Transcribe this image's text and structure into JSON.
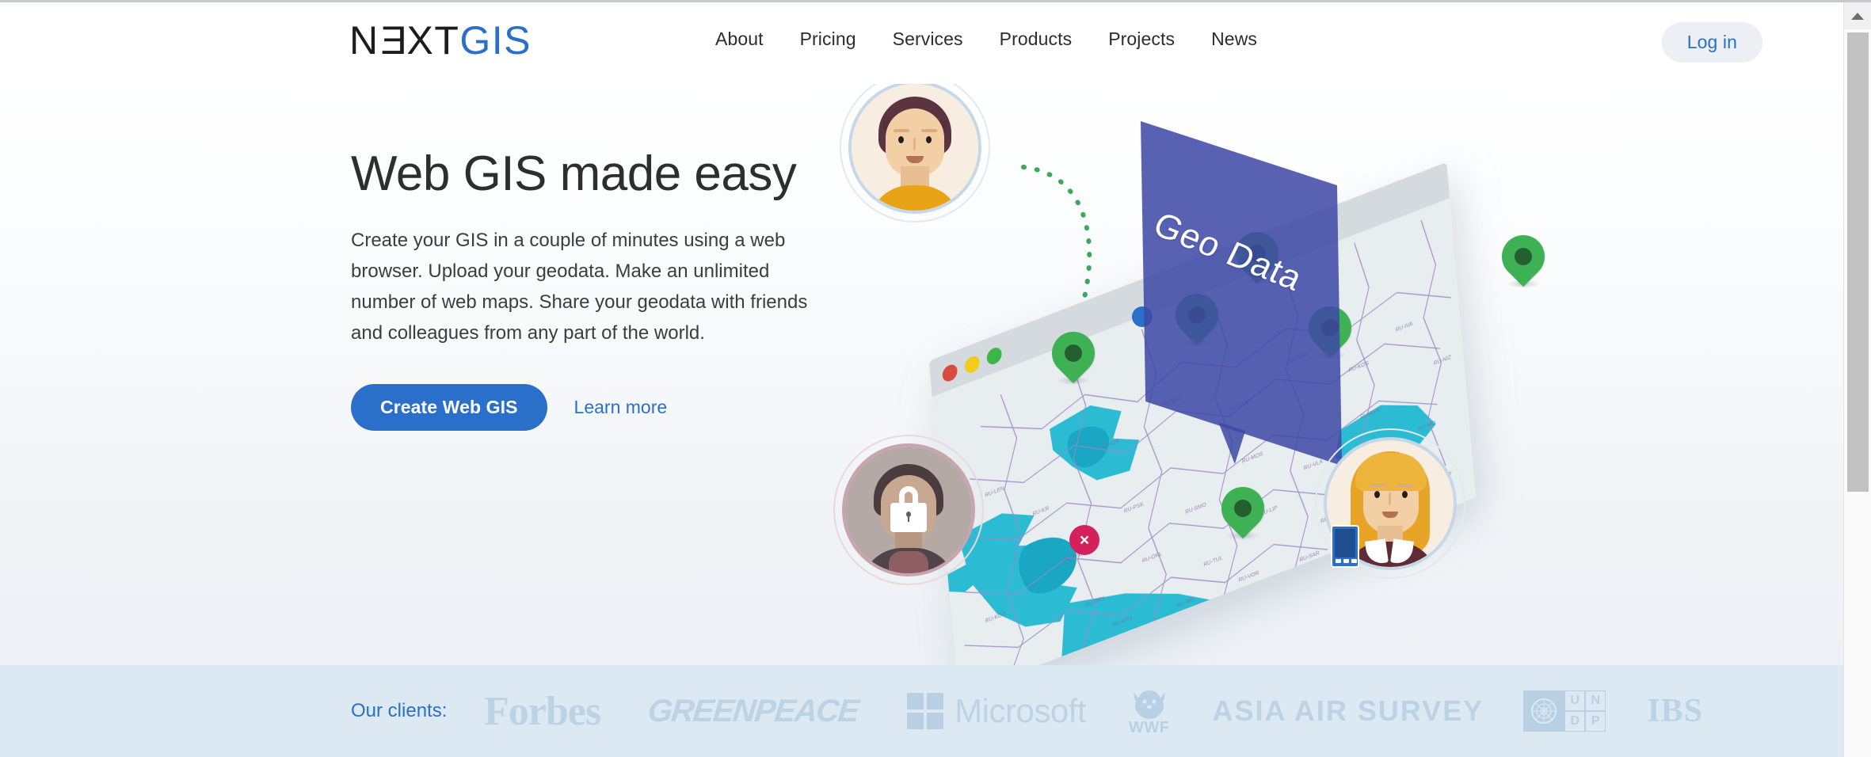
{
  "brand": {
    "logo_text_dark_1": "N",
    "logo_text_e": "E",
    "logo_text_dark_2": "XT",
    "logo_text_blue": "GIS",
    "logo_full": "NEXTGIS",
    "accent_blue": "#2a6fc9",
    "marker_green": "#3eb155",
    "bubble_indigo": "#3e48a5",
    "alert_crimson": "#d3215c"
  },
  "header": {
    "nav": [
      {
        "label": "About"
      },
      {
        "label": "Pricing"
      },
      {
        "label": "Services"
      },
      {
        "label": "Products"
      },
      {
        "label": "Projects"
      },
      {
        "label": "News"
      }
    ],
    "login_label": "Log in"
  },
  "hero": {
    "title": "Web GIS made easy",
    "subtitle": "Create your GIS in a couple of minutes using a web browser. Upload your geodata. Make an unlimited number of web maps. Share your geodata with friends and colleagues from any part of the world.",
    "primary_cta": "Create Web GIS",
    "secondary_cta": "Learn more"
  },
  "illustration": {
    "bubble_label": "Geo Data",
    "x_badge_label": "×",
    "avatars": [
      {
        "name": "avatar-user-male",
        "state": "active"
      },
      {
        "name": "avatar-user-locked",
        "state": "locked"
      },
      {
        "name": "avatar-user-female",
        "state": "active"
      }
    ],
    "marker_count": 6,
    "blue_dot_count": 2,
    "window_dots": [
      "red",
      "yellow",
      "green"
    ]
  },
  "clients": {
    "label": "Our clients:",
    "logos": [
      {
        "name": "Forbes"
      },
      {
        "name": "GREENPEACE"
      },
      {
        "name": "Microsoft"
      },
      {
        "name": "WWF"
      },
      {
        "name": "ASIA AIR SURVEY"
      },
      {
        "name": "UNDP",
        "line1": "UN",
        "line2": "DP",
        "u": "U",
        "n": "N",
        "d": "D",
        "p": "P"
      },
      {
        "name": "IBS"
      }
    ]
  }
}
